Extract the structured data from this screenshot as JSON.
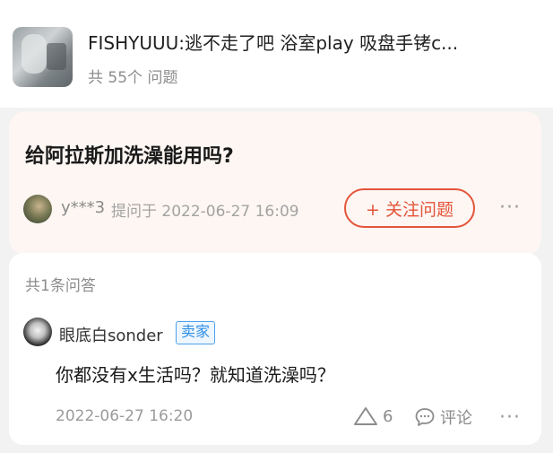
{
  "product": {
    "title": "FISHYUUU:逃不走了吧 浴室play 吸盘手铐c...",
    "question_count": "共 55个 问题"
  },
  "question": {
    "title": "给阿拉斯加洗澡能用吗?",
    "asker": "y***3",
    "asked_meta": "提问于 2022-06-27 16:09",
    "follow_label": "+ 关注问题",
    "more": "···"
  },
  "answers": {
    "count_label": "共1条问答",
    "items": [
      {
        "author": "眼底白sonder",
        "badge": "卖家",
        "text": "你都没有x生活吗？就知道洗澡吗？",
        "time": "2022-06-27 16:20",
        "likes": "6",
        "comment_label": "评论",
        "more": "···"
      }
    ]
  },
  "colors": {
    "accent": "#e4543a",
    "badge": "#2f8fe6",
    "question_card_bg": "#fdf6f2"
  },
  "icons": {
    "like": "triangle-like-icon",
    "comment": "comment-bubble-icon",
    "more": "more-dots-icon"
  }
}
